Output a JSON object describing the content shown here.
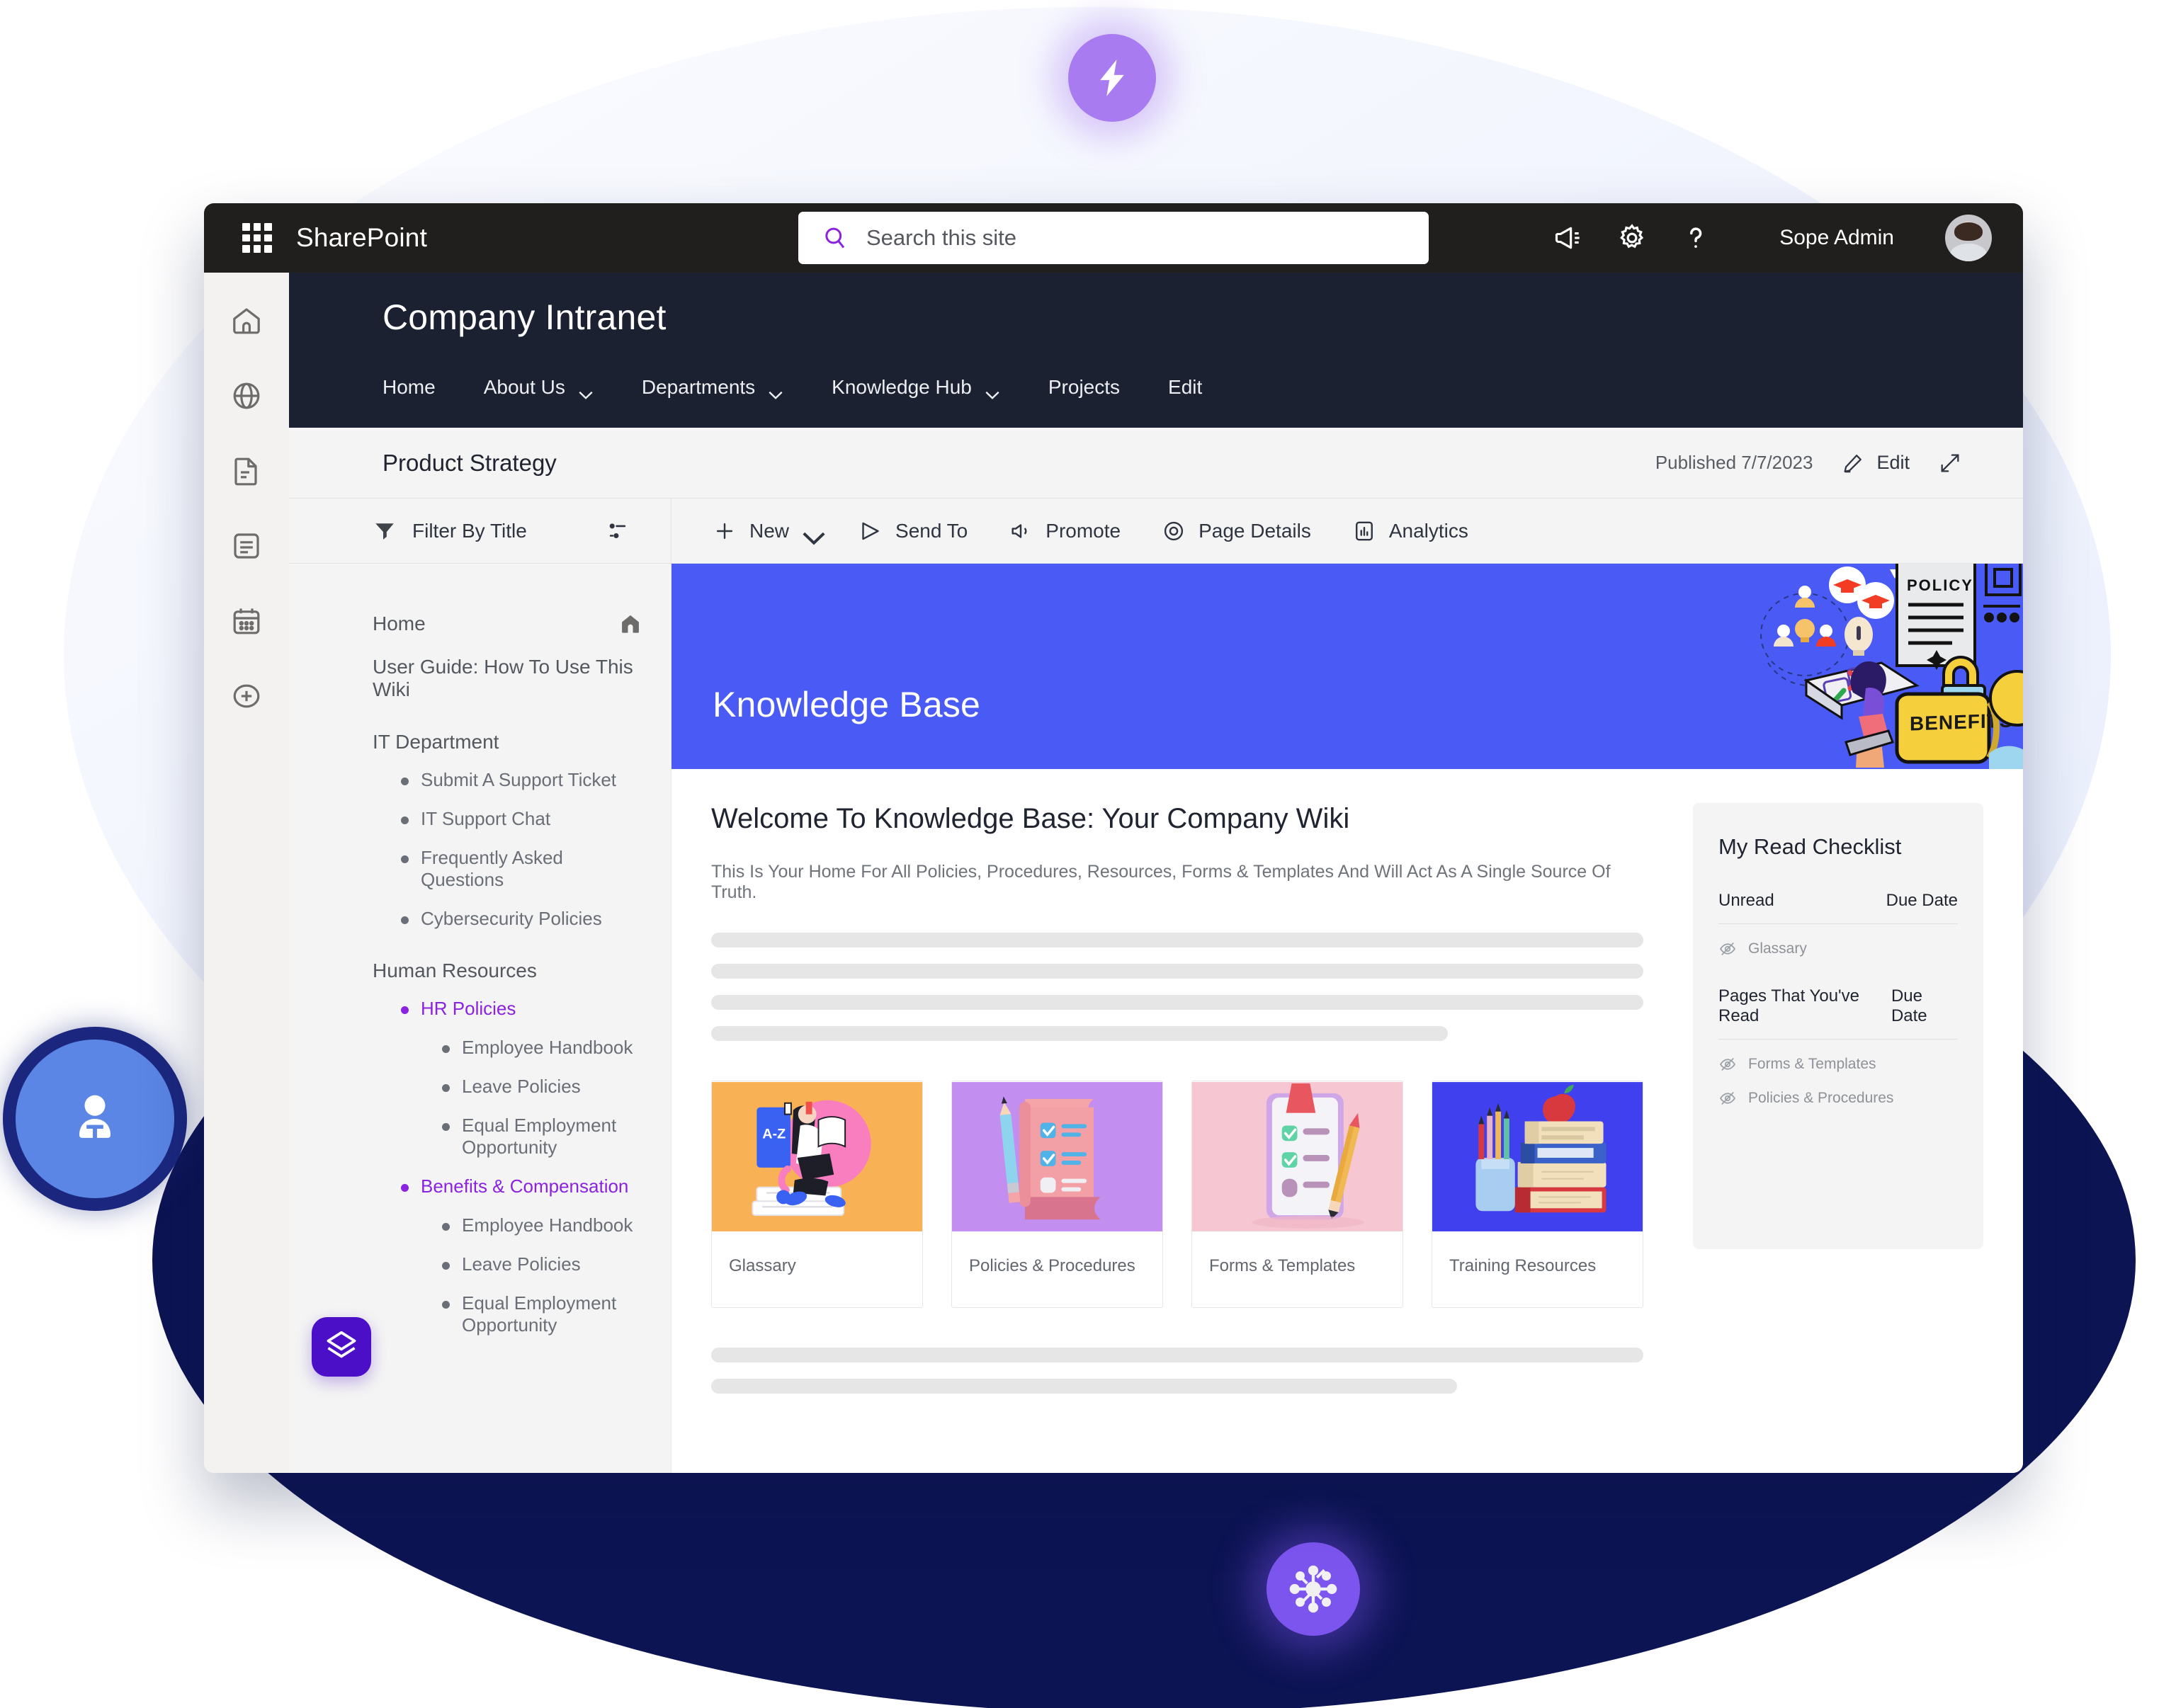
{
  "suite": {
    "waffle_icon": "app-launcher-icon",
    "brand": "SharePoint",
    "search_placeholder": "Search this site",
    "search_value": "",
    "search_icon": "search-icon",
    "icons": [
      "megaphone-icon",
      "gear-icon",
      "help-icon"
    ],
    "user_name": "Sope Admin",
    "avatar_icon": "user-avatar"
  },
  "rail": {
    "items": [
      {
        "name": "home-icon"
      },
      {
        "name": "globe-icon"
      },
      {
        "name": "document-icon"
      },
      {
        "name": "list-icon"
      },
      {
        "name": "calendar-icon"
      },
      {
        "name": "add-icon"
      }
    ]
  },
  "site": {
    "title": "Company Intranet",
    "nav": [
      {
        "label": "Home",
        "has_chevron": false
      },
      {
        "label": "About Us",
        "has_chevron": true
      },
      {
        "label": "Departments",
        "has_chevron": true
      },
      {
        "label": "Knowledge Hub",
        "has_chevron": true
      },
      {
        "label": "Projects",
        "has_chevron": false
      },
      {
        "label": "Edit",
        "has_chevron": false
      }
    ]
  },
  "page_header": {
    "title": "Product Strategy",
    "published": "Published 7/7/2023",
    "edit_label": "Edit",
    "edit_icon": "pencil-icon",
    "expand_icon": "expand-icon"
  },
  "command_bar": {
    "filter_label": "Filter By Title",
    "filter_icon": "funnel-icon",
    "sort_icon": "sort-options-icon",
    "buttons": [
      {
        "label": "New",
        "icon": "plus-icon",
        "chevron": true
      },
      {
        "label": "Send To",
        "icon": "send-icon",
        "chevron": false
      },
      {
        "label": "Promote",
        "icon": "promote-icon",
        "chevron": false
      },
      {
        "label": "Page Details",
        "icon": "page-details-icon",
        "chevron": false
      },
      {
        "label": "Analytics",
        "icon": "analytics-icon",
        "chevron": false
      }
    ]
  },
  "tree": {
    "home_label": "Home",
    "home_icon": "home-filled-icon",
    "user_guide": "User Guide: How To Use This Wiki",
    "groups": [
      {
        "label": "IT Department",
        "items": [
          {
            "label": "Submit A Support Ticket",
            "accent": false,
            "children": []
          },
          {
            "label": "IT Support Chat",
            "accent": false,
            "children": []
          },
          {
            "label": "Frequently Asked Questions",
            "accent": false,
            "children": []
          },
          {
            "label": "Cybersecurity Policies",
            "accent": false,
            "children": []
          }
        ]
      },
      {
        "label": "Human Resources",
        "items": [
          {
            "label": "HR Policies",
            "accent": true,
            "children": [
              "Employee Handbook",
              "Leave Policies",
              "Equal Employment Opportunity"
            ]
          },
          {
            "label": "Benefits & Compensation",
            "accent": true,
            "children": [
              "Employee Handbook",
              "Leave Policies",
              "Equal Employment Opportunity"
            ]
          }
        ]
      }
    ],
    "brand_chip_icon": "stacked-layers-logo"
  },
  "hero": {
    "title": "Knowledge Base",
    "background_color": "#4a5bf5",
    "art_labels": [
      "POLICY",
      "BENEFITS"
    ]
  },
  "content": {
    "welcome_heading": "Welcome To Knowledge Base: Your Company Wiki",
    "welcome_text": "This Is Your Home For All Policies, Procedures, Resources, Forms & Templates And Will Act As A Single Source Of Truth.",
    "skeleton_top": [
      100,
      100,
      100,
      79
    ],
    "skeleton_bottom": [
      100,
      80
    ],
    "cards": [
      {
        "label": "Glassary",
        "bg": "#f8b154",
        "art": "az-book"
      },
      {
        "label": "Policies & Procedures",
        "bg": "#c28ef0",
        "art": "scroll-checklist"
      },
      {
        "label": "Forms & Templates",
        "bg": "#f6c6d2",
        "art": "clipboard-pencil"
      },
      {
        "label": "Training Resources",
        "bg": "#4040ef",
        "art": "books-apple"
      }
    ]
  },
  "checklist": {
    "title": "My Read Checklist",
    "unread_header": "Unread",
    "unread_due": "Due Date",
    "unread_items": [
      {
        "label": "Glassary",
        "icon": "eye-off-icon"
      }
    ],
    "read_header": "Pages That You've Read",
    "read_due": "Due Date",
    "read_items": [
      {
        "label": "Forms & Templates",
        "icon": "eye-off-icon"
      },
      {
        "label": "Policies & Procedures",
        "icon": "eye-off-icon"
      }
    ]
  },
  "decor": {
    "badges": [
      {
        "name": "lightning-badge",
        "color": "#a97bf0"
      },
      {
        "name": "network-node-badge",
        "color": "#7c55ef"
      },
      {
        "name": "person-badge",
        "color": "#5b86e5"
      }
    ]
  }
}
